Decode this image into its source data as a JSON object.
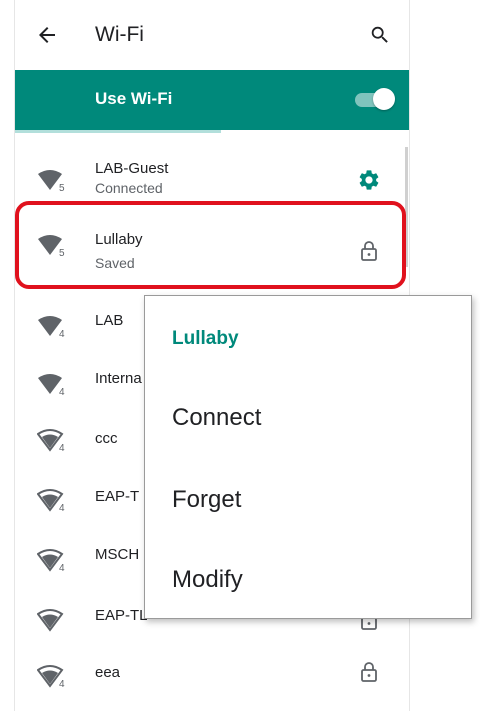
{
  "app_bar": {
    "title": "Wi-Fi",
    "back_icon": "arrow-back-icon",
    "search_icon": "search-icon"
  },
  "master_switch": {
    "label": "Use Wi-Fi",
    "checked": true,
    "accent_color": "#00897b"
  },
  "networks": [
    {
      "name": "LAB-Guest",
      "status": "Connected",
      "badge": "5",
      "trailing_icon": "gear-icon"
    },
    {
      "name": "Lullaby",
      "status": "Saved",
      "badge": "5",
      "trailing_icon": "lock-icon"
    },
    {
      "name": "LAB",
      "status": "",
      "badge": "4",
      "trailing_icon": ""
    },
    {
      "name": "Interna",
      "status": "",
      "badge": "4",
      "trailing_icon": ""
    },
    {
      "name": "ccc",
      "status": "",
      "badge": "4",
      "trailing_icon": ""
    },
    {
      "name": "EAP-T",
      "status": "",
      "badge": "4",
      "trailing_icon": ""
    },
    {
      "name": "MSCH",
      "status": "",
      "badge": "4",
      "trailing_icon": ""
    },
    {
      "name": "EAP-TL",
      "status": "",
      "badge": "",
      "trailing_icon": "lock-icon"
    },
    {
      "name": "eea",
      "status": "",
      "badge": "4",
      "trailing_icon": "lock-icon"
    }
  ],
  "context_menu": {
    "title": "Lullaby",
    "items": [
      "Connect",
      "Forget",
      "Modify"
    ]
  },
  "colors": {
    "accent": "#00897b",
    "highlight_border": "#e0111d",
    "icon": "#5f6368"
  }
}
